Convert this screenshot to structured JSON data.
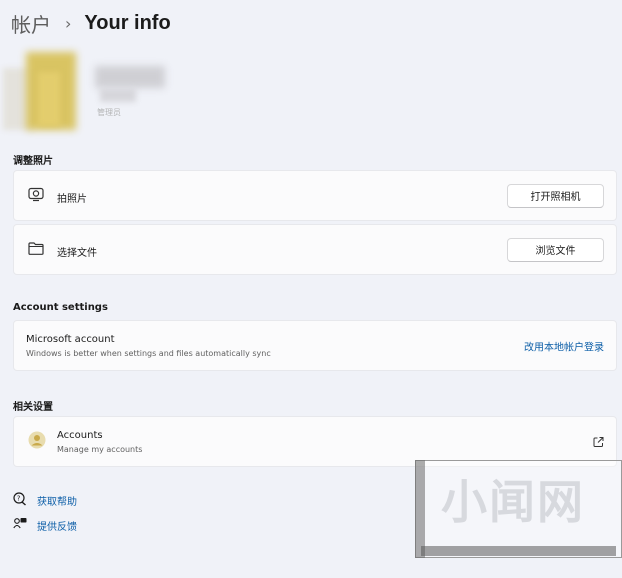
{
  "breadcrumb": {
    "parent": "帐户",
    "separator": "›",
    "current": "Your info"
  },
  "profile": {
    "role": "管理员"
  },
  "sections": {
    "photo": "调整照片",
    "account_settings": "Account settings",
    "related": "相关设置"
  },
  "photo_rows": [
    {
      "icon": "camera-icon",
      "label": "拍照片",
      "button": "打开照相机"
    },
    {
      "icon": "folder-icon",
      "label": "选择文件",
      "button": "浏览文件"
    }
  ],
  "microsoft_account": {
    "title": "Microsoft account",
    "subtitle": "Windows is better when settings and files automatically sync",
    "action": "改用本地帐户登录"
  },
  "accounts_row": {
    "icon": "accounts-icon",
    "title": "Accounts",
    "subtitle": "Manage my accounts",
    "action_icon": "external-link-icon"
  },
  "help_links": [
    {
      "icon": "help-icon",
      "label": "获取帮助"
    },
    {
      "icon": "feedback-icon",
      "label": "提供反馈"
    }
  ],
  "watermark": {
    "text": "小闻网"
  },
  "colors": {
    "background": "#f0f2f8",
    "card": "#fbfbfc",
    "link": "#0d5fa8"
  }
}
